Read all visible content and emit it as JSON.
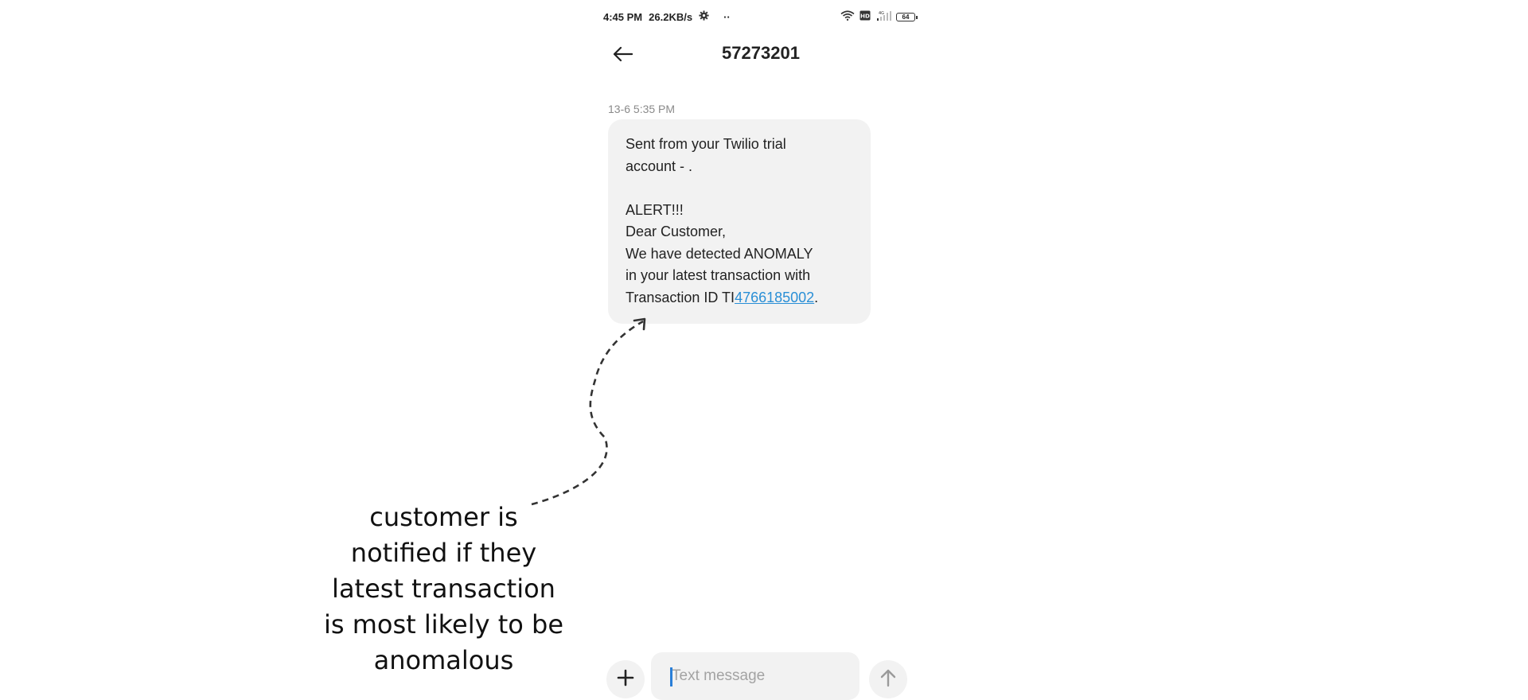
{
  "status_bar": {
    "time": "4:45 PM",
    "network_speed": "26.2KB/s",
    "more": "··",
    "battery": "64",
    "icons": [
      "settings-gear-icon",
      "wifi-icon",
      "hd-icon",
      "signal-icon",
      "battery-icon"
    ]
  },
  "header": {
    "back_icon": "arrow-left-icon",
    "title": "57273201"
  },
  "message": {
    "timestamp": "13-6 5:35 PM",
    "body": "Sent from your Twilio trial\naccount - .\n\nALERT!!!\nDear Customer,\nWe have detected ANOMALY\nin your latest transaction with\nTransaction ID TI",
    "link_text": "4766185002",
    "trailing": "."
  },
  "annotation": {
    "text": "customer is notified if they latest transaction is most likely to be anomalous"
  },
  "compose": {
    "add_icon": "plus-icon",
    "placeholder": "Text message",
    "send_icon": "arrow-up-icon"
  },
  "colors": {
    "bubble": "#f2f2f2",
    "link": "#2a8fd6",
    "caret": "#2a7fd8"
  }
}
